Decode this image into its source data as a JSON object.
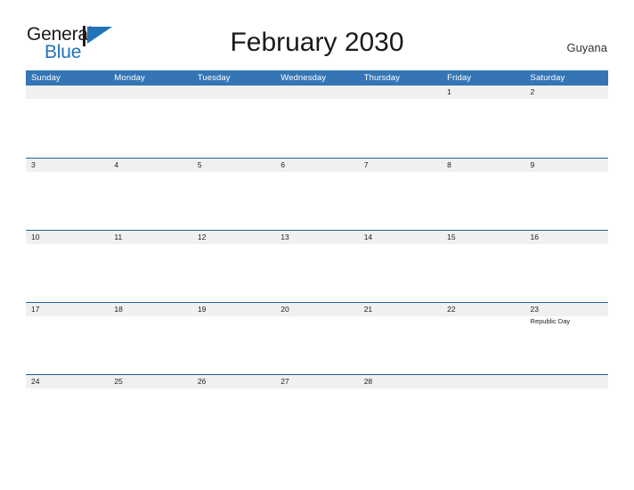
{
  "brand": {
    "name_part1": "General",
    "name_part2": "Blue",
    "flag_color": "#2272b8"
  },
  "header": {
    "title": "February 2030",
    "country": "Guyana"
  },
  "theme": {
    "header_blue": "#3575b5",
    "divider_blue": "#1f639c",
    "strip_gray": "#f0f0f0",
    "text_dark": "#222222"
  },
  "calendar": {
    "month": "February",
    "year": "2030",
    "weekday_headers": [
      "Sunday",
      "Monday",
      "Tuesday",
      "Wednesday",
      "Thursday",
      "Friday",
      "Saturday"
    ],
    "weeks": [
      {
        "days": [
          {
            "num": "",
            "events": []
          },
          {
            "num": "",
            "events": []
          },
          {
            "num": "",
            "events": []
          },
          {
            "num": "",
            "events": []
          },
          {
            "num": "",
            "events": []
          },
          {
            "num": "1",
            "events": []
          },
          {
            "num": "2",
            "events": []
          }
        ]
      },
      {
        "days": [
          {
            "num": "3",
            "events": []
          },
          {
            "num": "4",
            "events": []
          },
          {
            "num": "5",
            "events": []
          },
          {
            "num": "6",
            "events": []
          },
          {
            "num": "7",
            "events": []
          },
          {
            "num": "8",
            "events": []
          },
          {
            "num": "9",
            "events": []
          }
        ]
      },
      {
        "days": [
          {
            "num": "10",
            "events": []
          },
          {
            "num": "11",
            "events": []
          },
          {
            "num": "12",
            "events": []
          },
          {
            "num": "13",
            "events": []
          },
          {
            "num": "14",
            "events": []
          },
          {
            "num": "15",
            "events": []
          },
          {
            "num": "16",
            "events": []
          }
        ]
      },
      {
        "days": [
          {
            "num": "17",
            "events": []
          },
          {
            "num": "18",
            "events": []
          },
          {
            "num": "19",
            "events": []
          },
          {
            "num": "20",
            "events": []
          },
          {
            "num": "21",
            "events": []
          },
          {
            "num": "22",
            "events": []
          },
          {
            "num": "23",
            "events": [
              "Republic Day"
            ]
          }
        ]
      },
      {
        "days": [
          {
            "num": "24",
            "events": []
          },
          {
            "num": "25",
            "events": []
          },
          {
            "num": "26",
            "events": []
          },
          {
            "num": "27",
            "events": []
          },
          {
            "num": "28",
            "events": []
          },
          {
            "num": "",
            "events": []
          },
          {
            "num": "",
            "events": []
          }
        ]
      }
    ]
  }
}
